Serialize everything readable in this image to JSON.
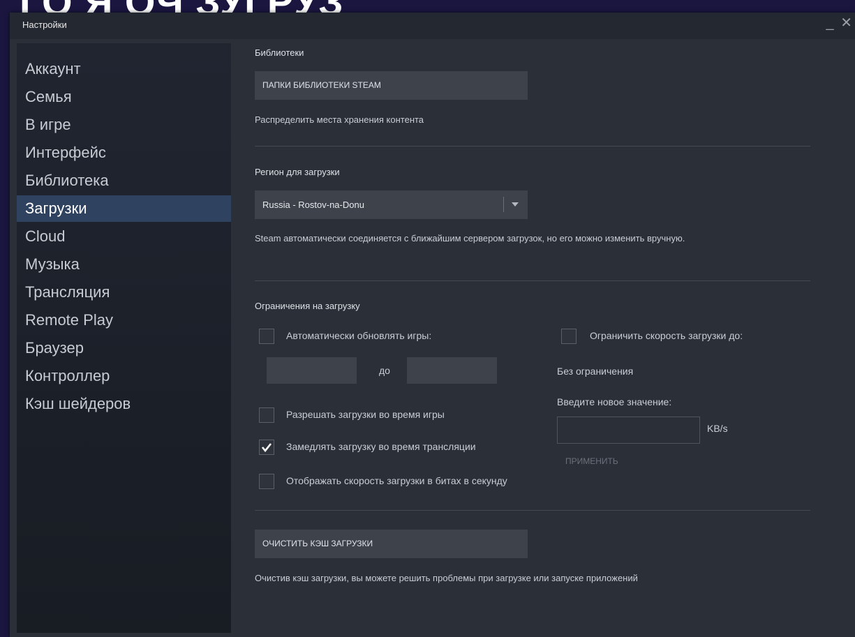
{
  "backdrop": {
    "title_fragment": "ГО   Я   ОЧ   ЗУГРУЗ"
  },
  "window": {
    "title": "Настройки",
    "minimize": "_",
    "close": "✕"
  },
  "sidebar": {
    "items": [
      {
        "label": "Аккаунт"
      },
      {
        "label": "Семья"
      },
      {
        "label": "В игре"
      },
      {
        "label": "Интерфейс"
      },
      {
        "label": "Библиотека"
      },
      {
        "label": "Загрузки"
      },
      {
        "label": "Cloud"
      },
      {
        "label": "Музыка"
      },
      {
        "label": "Трансляция"
      },
      {
        "label": "Remote Play"
      },
      {
        "label": "Браузер"
      },
      {
        "label": "Контроллер"
      },
      {
        "label": "Кэш шейдеров"
      }
    ],
    "active": "Загрузки"
  },
  "libraries": {
    "heading": "Библиотеки",
    "button": "ПАПКИ БИБЛИОТЕКИ STEAM",
    "desc": "Распределить места хранения контента"
  },
  "region": {
    "heading": "Регион для загрузки",
    "selected": "Russia - Rostov-na-Donu",
    "desc": "Steam автоматически соединяется с ближайшим сервером загрузок, но его можно изменить вручную."
  },
  "limits": {
    "heading": "Ограничения на загрузку",
    "auto_update": {
      "label": "Автоматически обновлять игры:",
      "checked": false
    },
    "time_from": "",
    "time_sep": "до",
    "time_to": "",
    "allow_in_game": {
      "label": "Разрешать загрузки во время игры",
      "checked": false
    },
    "throttle_broadcast": {
      "label": "Замедлять загрузку во время трансляции",
      "checked": true
    },
    "show_bits": {
      "label": "Отображать скорость загрузки в битах в секунду",
      "checked": false
    },
    "limit_speed": {
      "label": "Ограничить скорость загрузки до:",
      "checked": false
    },
    "current_limit": "Без ограничения",
    "new_value_label": "Введите новое значение:",
    "new_value": "",
    "unit": "KB/s",
    "apply": "ПРИМЕНИТЬ"
  },
  "cache": {
    "button": "ОЧИСТИТЬ КЭШ ЗАГРУЗКИ",
    "desc": "Очистив кэш загрузки, вы можете решить проблемы при загрузке или запуске приложений"
  },
  "icons": {
    "checkmark": "checkmark-icon",
    "dropdown": "chevron-down-icon"
  }
}
